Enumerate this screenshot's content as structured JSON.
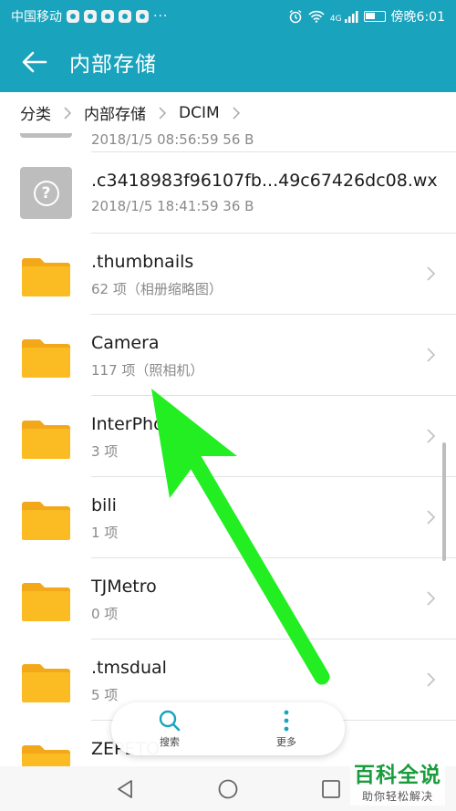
{
  "status_bar": {
    "carrier": "中国移动",
    "dots": "···",
    "network": "4G",
    "time": "傍晚6:01"
  },
  "app_bar": {
    "title": "内部存储"
  },
  "breadcrumb": [
    "分类",
    "内部存储",
    "DCIM"
  ],
  "partial_row": {
    "meta": "2018/1/5 08:56:59 56 B"
  },
  "items": [
    {
      "name": ".c3418983f96107fb...49c67426dc08.wx",
      "meta": "2018/1/5 18:41:59 36 B",
      "type": "file"
    },
    {
      "name": ".thumbnails",
      "meta": "62 项（相册缩略图）",
      "type": "folder"
    },
    {
      "name": "Camera",
      "meta": "117 项（照相机）",
      "type": "folder"
    },
    {
      "name": "InterPho",
      "meta": "3 项",
      "type": "folder"
    },
    {
      "name": "bili",
      "meta": "1 项",
      "type": "folder"
    },
    {
      "name": "TJMetro",
      "meta": "0 项",
      "type": "folder"
    },
    {
      "name": ".tmsdual",
      "meta": "5 项",
      "type": "folder"
    },
    {
      "name": "ZEPETO",
      "meta": "",
      "type": "folder"
    }
  ],
  "floating_bar": {
    "search_label": "搜索",
    "more_label": "更多"
  },
  "watermark": {
    "title": "百科全说",
    "subtitle": "助你轻松解决"
  },
  "colors": {
    "header": "#1aa3bd",
    "folder": "#fbbc23",
    "folder_tab": "#f3a81a",
    "arrow": "#22ee22",
    "watermark": "#1a9c3d"
  }
}
